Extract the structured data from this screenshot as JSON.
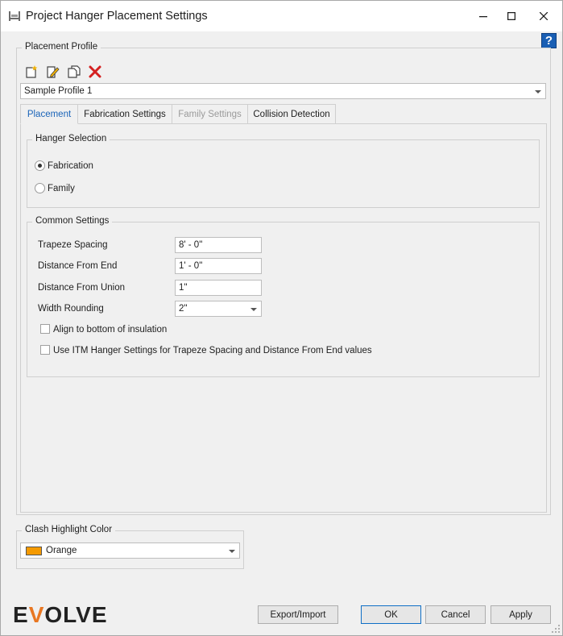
{
  "window": {
    "title": "Project Hanger Placement Settings",
    "help_label": "?"
  },
  "placement_profile": {
    "group_label": "Placement Profile",
    "toolbar_icons": [
      "new-profile-icon",
      "edit-profile-icon",
      "copy-profile-icon",
      "delete-profile-icon"
    ],
    "selected_profile": "Sample Profile 1"
  },
  "tabs": [
    {
      "label": "Placement",
      "state": "active"
    },
    {
      "label": "Fabrication Settings",
      "state": "normal"
    },
    {
      "label": "Family Settings",
      "state": "disabled"
    },
    {
      "label": "Collision Detection",
      "state": "normal"
    }
  ],
  "hanger_selection": {
    "group_label": "Hanger Selection",
    "options": [
      {
        "label": "Fabrication",
        "checked": true
      },
      {
        "label": "Family",
        "checked": false
      }
    ]
  },
  "common_settings": {
    "group_label": "Common Settings",
    "fields": [
      {
        "label": "Trapeze Spacing",
        "value": "8' - 0\""
      },
      {
        "label": "Distance From End",
        "value": "1' - 0\""
      },
      {
        "label": "Distance From Union",
        "value": "1\""
      },
      {
        "label": "Width Rounding",
        "value": "2\""
      }
    ],
    "checkboxes": [
      {
        "label": "Align to bottom of insulation",
        "checked": false
      },
      {
        "label": "Use ITM Hanger Settings for Trapeze Spacing and Distance From End values",
        "checked": false
      }
    ]
  },
  "clash_highlight": {
    "group_label": "Clash Highlight Color",
    "selected": "Orange",
    "swatch_color": "#f59a00"
  },
  "footer": {
    "logo_text_pre": "E",
    "logo_text_accent": "V",
    "logo_text_post": "OLVE",
    "buttons": {
      "export_import": "Export/Import",
      "ok": "OK",
      "cancel": "Cancel",
      "apply": "Apply"
    }
  },
  "colors": {
    "accent": "#1a64b8",
    "logo_accent": "#e87722"
  }
}
